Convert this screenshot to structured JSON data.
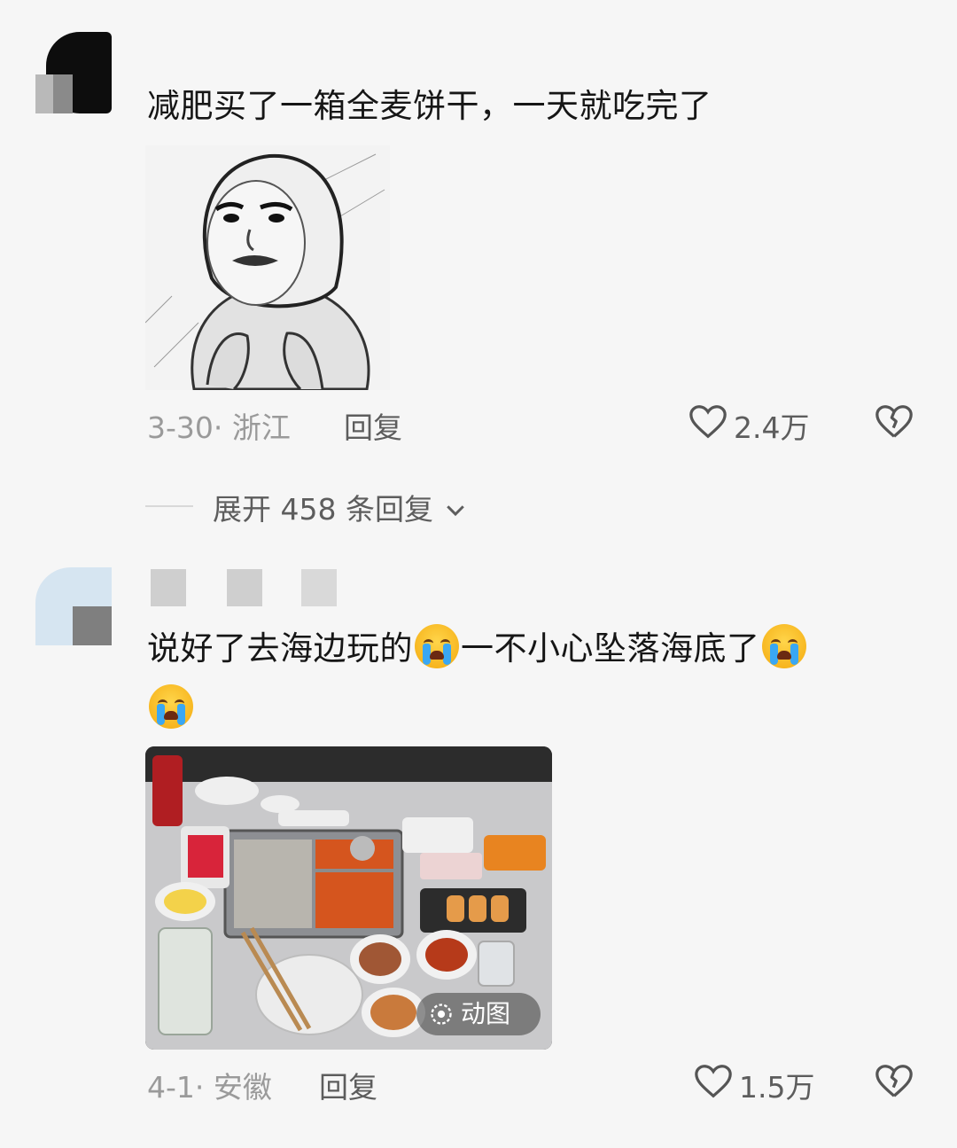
{
  "comments": [
    {
      "text": "减肥买了一箱全麦饼干，一天就吃完了",
      "date": "3-30",
      "location": "浙江",
      "reply_label": "回复",
      "likes": "2.4万",
      "expand_replies": "展开 458 条回复"
    },
    {
      "text_part1": "说好了去海边玩的",
      "text_part2": "一不小心坠落海底了",
      "emoji": "loudly-crying-face",
      "gif_label": "动图",
      "date": "4-1",
      "location": "安徽",
      "reply_label": "回复",
      "likes": "1.5万"
    }
  ],
  "colors": {
    "background": "#f6f6f6",
    "text": "#161616",
    "meta": "#9a9a9a",
    "action": "#5d5d5d"
  }
}
